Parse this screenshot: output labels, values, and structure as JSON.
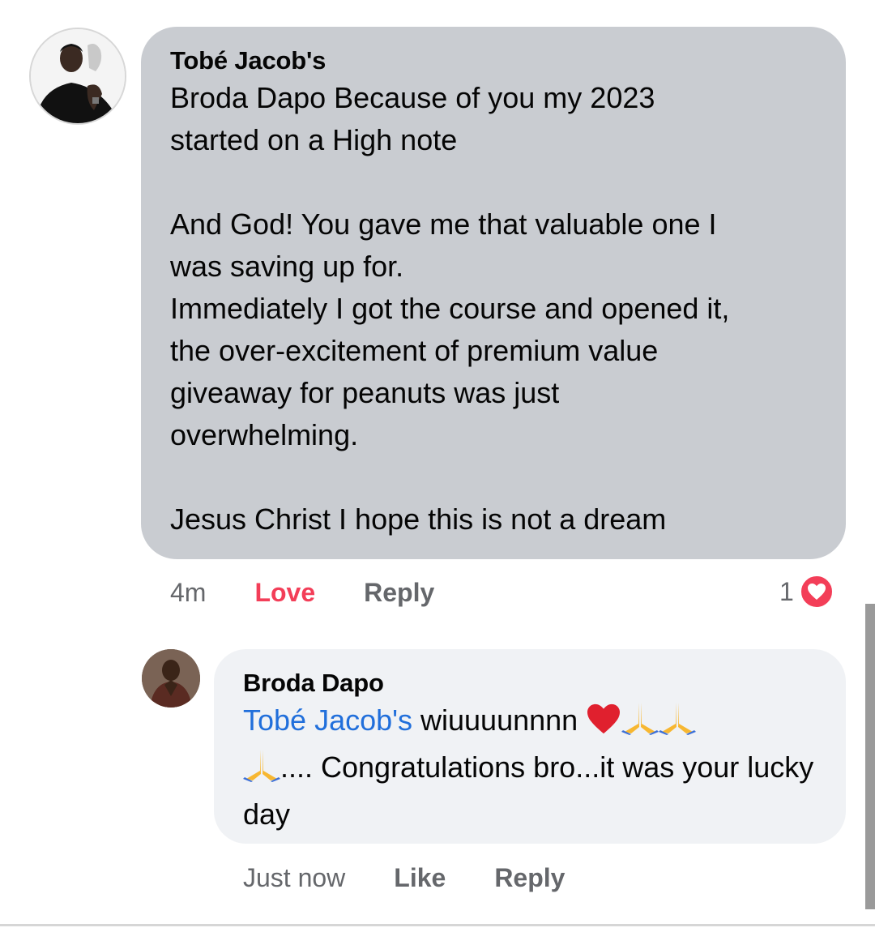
{
  "comment": {
    "author": "Tobé Jacob's",
    "text": "Broda Dapo Because of you my 2023\nstarted on a High note\n\nAnd God! You gave me that valuable one I\nwas saving up for.\nImmediately I got the course and opened it,\nthe over-excitement of premium value\ngiveaway for peanuts was just\noverwhelming.\n\nJesus Christ I hope this is not a dream",
    "time": "4m",
    "reaction_label": "Love",
    "reply_label": "Reply",
    "reaction_count": "1",
    "reaction_icon": "heart-icon",
    "colors": {
      "bubble": "#c9ccd1",
      "love": "#f33e58"
    }
  },
  "reply": {
    "author": "Broda Dapo",
    "mention": "Tobé Jacob's",
    "text_part1": " wiuuuunnnn ",
    "text_part2": "....  Congratulations bro...it was your lucky day",
    "time": "Just now",
    "like_label": "Like",
    "reply_label": "Reply",
    "colors": {
      "bubble": "#f0f2f5",
      "mention": "#216fdb"
    },
    "emojis": [
      "red-heart-icon",
      "folded-hands-icon",
      "folded-hands-icon",
      "folded-hands-icon"
    ]
  }
}
